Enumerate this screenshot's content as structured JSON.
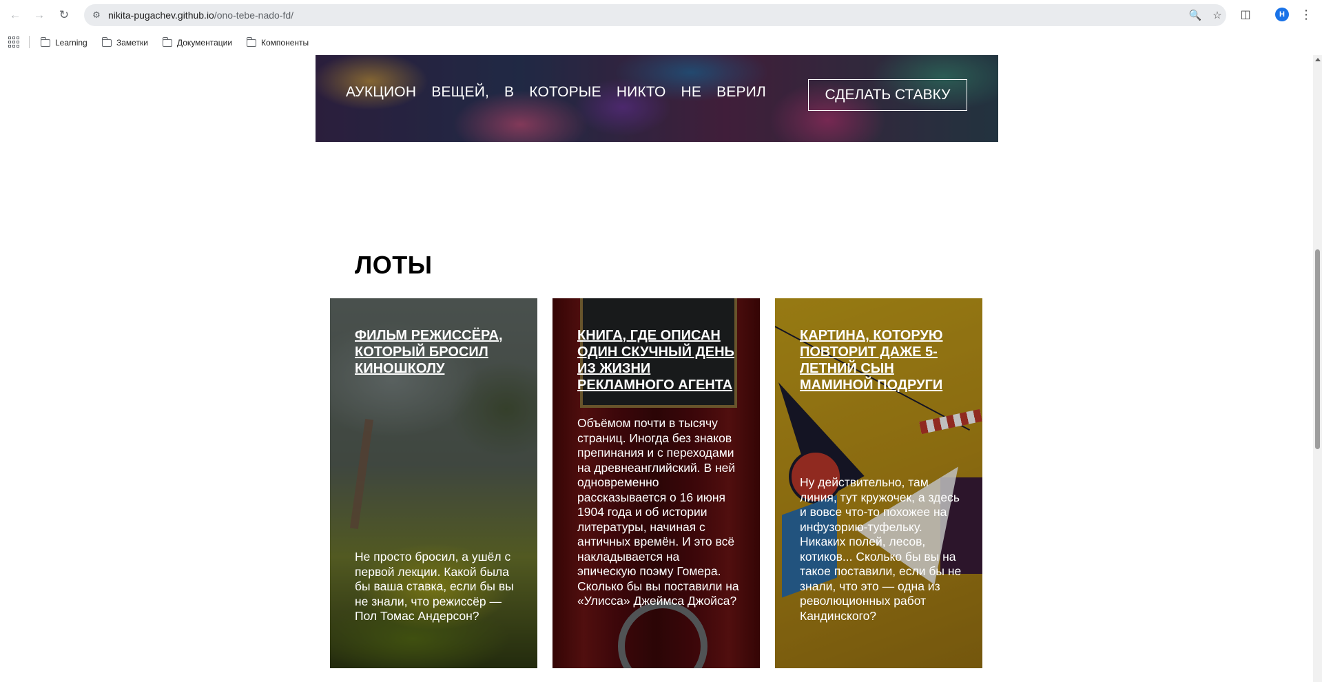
{
  "browser": {
    "url_host": "nikita-pugachev.github.io",
    "url_path": "/ono-tebe-nado-fd/",
    "profile_initial": "H",
    "bookmarks": [
      {
        "label": "Learning"
      },
      {
        "label": "Заметки"
      },
      {
        "label": "Документации"
      },
      {
        "label": "Компоненты"
      }
    ]
  },
  "hero": {
    "words": [
      "АУКЦИОН",
      "ВЕЩЕЙ,",
      "В",
      "КОТОРЫЕ",
      "НИКТО",
      "НЕ",
      "ВЕРИЛ"
    ],
    "bid_button": "СДЕЛАТЬ СТАВКУ"
  },
  "lots": {
    "heading": "ЛОТЫ",
    "cards": [
      {
        "title": "ФИЛЬМ РЕЖИССЁРА, КОТОРЫЙ БРОСИЛ КИНОШКОЛУ",
        "text": "Не просто бросил, а ушёл с первой лекции. Какой была бы ваша ставка, если бы вы не знали, что режиссёр — Пол Томас Андерсон?"
      },
      {
        "title": "КНИГА, ГДЕ ОПИСАН ОДИН СКУЧНЫЙ ДЕНЬ ИЗ ЖИЗНИ РЕКЛАМНОГО АГЕНТА",
        "text": "Объёмом почти в тысячу страниц. Иногда без знаков препинания и с переходами на древнеанглийский. В ней одновременно рассказывается о 16 июня 1904 года и об истории литературы, начиная с античных времён. И это всё накладывается на эпическую поэму Гомера. Сколько бы вы поставили на «Улисса» Джеймса Джойса?"
      },
      {
        "title": "КАРТИНА, КОТОРУЮ ПОВТОРИТ ДАЖЕ 5-ЛЕТНИЙ СЫН МАМИНОЙ ПОДРУГИ",
        "text": "Ну действительно, там линия, тут кружочек, а здесь и вовсе что-то похожее на инфузорию-туфельку. Никаких полей, лесов, котиков... Сколько бы вы на такое поставили, если бы не знали, что это — одна из революционных работ Кандинского?"
      }
    ]
  }
}
